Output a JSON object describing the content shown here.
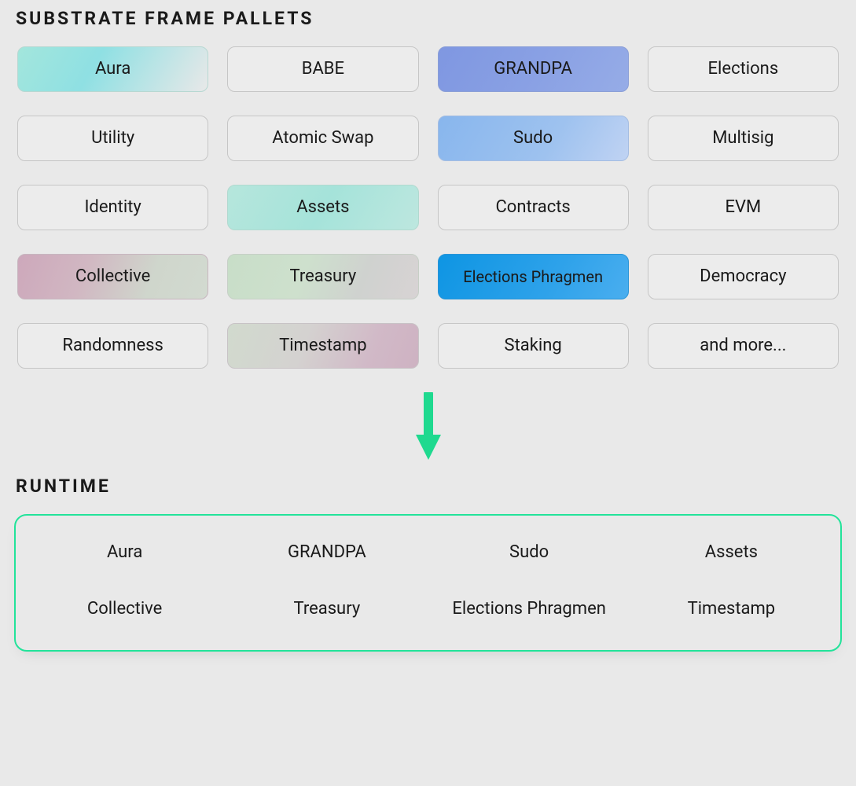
{
  "sections": {
    "pallets_title": "SUBSTRATE FRAME PALLETS",
    "runtime_title": "RUNTIME"
  },
  "pallets": [
    {
      "label": "Aura",
      "highlight": "aura"
    },
    {
      "label": "BABE",
      "highlight": null
    },
    {
      "label": "GRANDPA",
      "highlight": "grandpa"
    },
    {
      "label": "Elections",
      "highlight": null
    },
    {
      "label": "Utility",
      "highlight": null
    },
    {
      "label": "Atomic Swap",
      "highlight": null
    },
    {
      "label": "Sudo",
      "highlight": "sudo"
    },
    {
      "label": "Multisig",
      "highlight": null
    },
    {
      "label": "Identity",
      "highlight": null
    },
    {
      "label": "Assets",
      "highlight": "assets"
    },
    {
      "label": "Contracts",
      "highlight": null
    },
    {
      "label": "EVM",
      "highlight": null
    },
    {
      "label": "Collective",
      "highlight": "collective"
    },
    {
      "label": "Treasury",
      "highlight": "treasury"
    },
    {
      "label": "Elections Phragmen",
      "highlight": "elections-phragmen",
      "multiline": true
    },
    {
      "label": "Democracy",
      "highlight": null
    },
    {
      "label": "Randomness",
      "highlight": null
    },
    {
      "label": "Timestamp",
      "highlight": "timestamp"
    },
    {
      "label": "Staking",
      "highlight": null
    },
    {
      "label": "and more...",
      "highlight": null
    }
  ],
  "runtime": [
    "Aura",
    "GRANDPA",
    "Sudo",
    "Assets",
    "Collective",
    "Treasury",
    "Elections Phragmen",
    "Timestamp"
  ],
  "arrow_color": "#1fd98f"
}
